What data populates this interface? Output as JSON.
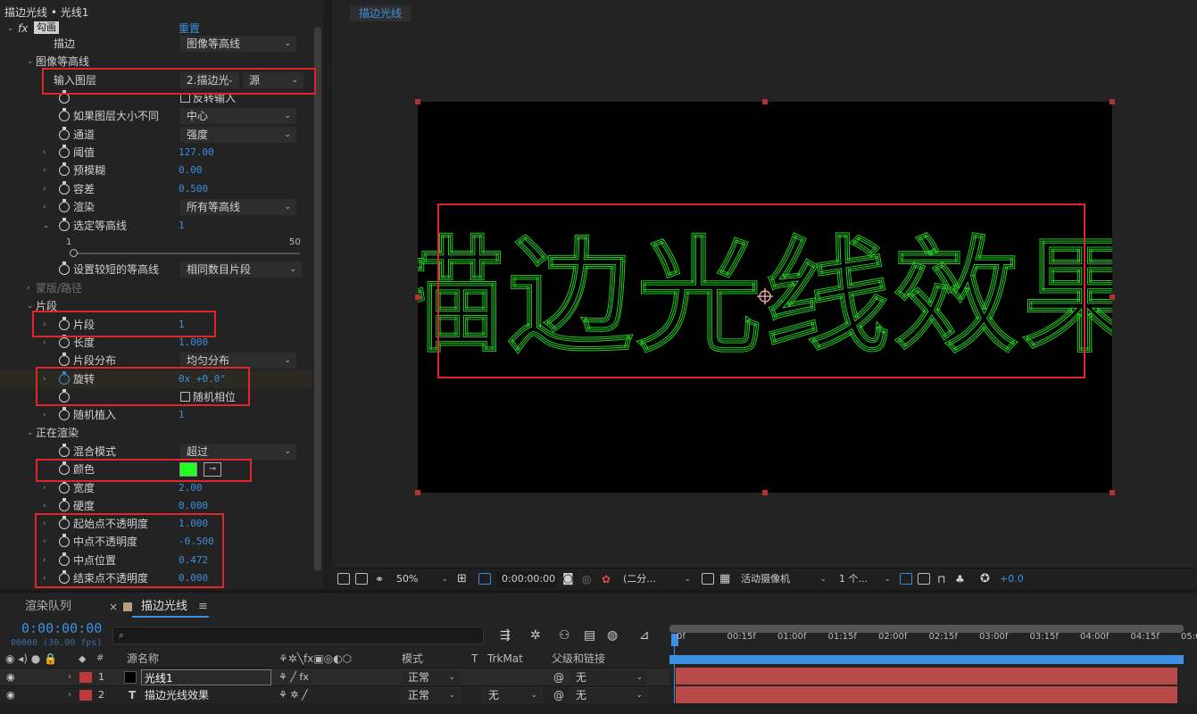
{
  "effect_controls": {
    "header": "描边光线 • 光线1",
    "fx_name": "勾画",
    "reset": "重置",
    "stroke_label": "描边",
    "stroke_value": "图像等高线",
    "contour_group": "图像等高线",
    "input_layer_label": "输入图层",
    "input_layer_value": "2.描边光",
    "input_source": "源",
    "invert_input": "反转输入",
    "if_size_differs_label": "如果图层大小不同",
    "if_size_differs_value": "中心",
    "channel_label": "通道",
    "channel_value": "强度",
    "threshold_label": "阈值",
    "threshold_value": "127.00",
    "preblur_label": "预模糊",
    "preblur_value": "0.00",
    "tolerance_label": "容差",
    "tolerance_value": "0.500",
    "render_label": "渲染",
    "render_value": "所有等高线",
    "selected_contour_label": "选定等高线",
    "selected_contour_value": "1",
    "slider_min": "1",
    "slider_max": "50",
    "shorter_contours_label": "设置较短的等高线",
    "shorter_contours_value": "相同数目片段",
    "mask_path_group": "蒙版/路径",
    "segments_group": "片段",
    "segments_label": "片段",
    "segments_value": "1",
    "length_label": "长度",
    "length_value": "1.000",
    "segment_dist_label": "片段分布",
    "segment_dist_value": "均匀分布",
    "rotation_label": "旋转",
    "rotation_value": "0x +0.0°",
    "random_phase": "随机相位",
    "random_seed_label": "随机植入",
    "random_seed_value": "1",
    "rendering_group": "正在渲染",
    "blend_mode_label": "混合模式",
    "blend_mode_value": "超过",
    "color_label": "颜色",
    "color_swatch": "#22ff22",
    "width_label": "宽度",
    "width_value": "2.00",
    "hardness_label": "硬度",
    "hardness_value": "0.000",
    "start_opacity_label": "起始点不透明度",
    "start_opacity_value": "1.000",
    "midpoint_opacity_label": "中点不透明度",
    "midpoint_opacity_value": "-0.500",
    "midpoint_position_label": "中点位置",
    "midpoint_position_value": "0.472",
    "end_opacity_label": "结束点不透明度",
    "end_opacity_value": "0.000"
  },
  "viewer": {
    "tab": "描边光线",
    "canvas_text": "描边光线效果",
    "stroke_color": "#22cc22",
    "zoom": "50%",
    "timecode": "0:00:00:00",
    "resolution": "(二分...",
    "camera": "活动摄像机",
    "views": "1 个...",
    "exposure": "+0.0"
  },
  "timeline": {
    "tab_render_queue": "渲染队列",
    "tab_comp": "描边光线",
    "current_time": "0:00:00:00",
    "fps": "00000 (30.00 fps)",
    "col_num": "#",
    "col_source": "源名称",
    "col_mode": "模式",
    "col_t": "T",
    "col_trkmat": "TrkMat",
    "col_parent": "父级和链接",
    "ruler": [
      "0f",
      "00:15f",
      "01:00f",
      "01:15f",
      "02:00f",
      "02:15f",
      "03:00f",
      "03:15f",
      "04:00f",
      "04:15f",
      "05:0"
    ],
    "layers": [
      {
        "num": "1",
        "name": "光线1",
        "mode": "正常",
        "trkmat": "",
        "parent": "无",
        "label_color": "#c0393c"
      },
      {
        "num": "2",
        "name": "描边光线效果",
        "mode": "正常",
        "trkmat": "无",
        "parent": "无",
        "label_color": "#c0393c"
      }
    ]
  }
}
